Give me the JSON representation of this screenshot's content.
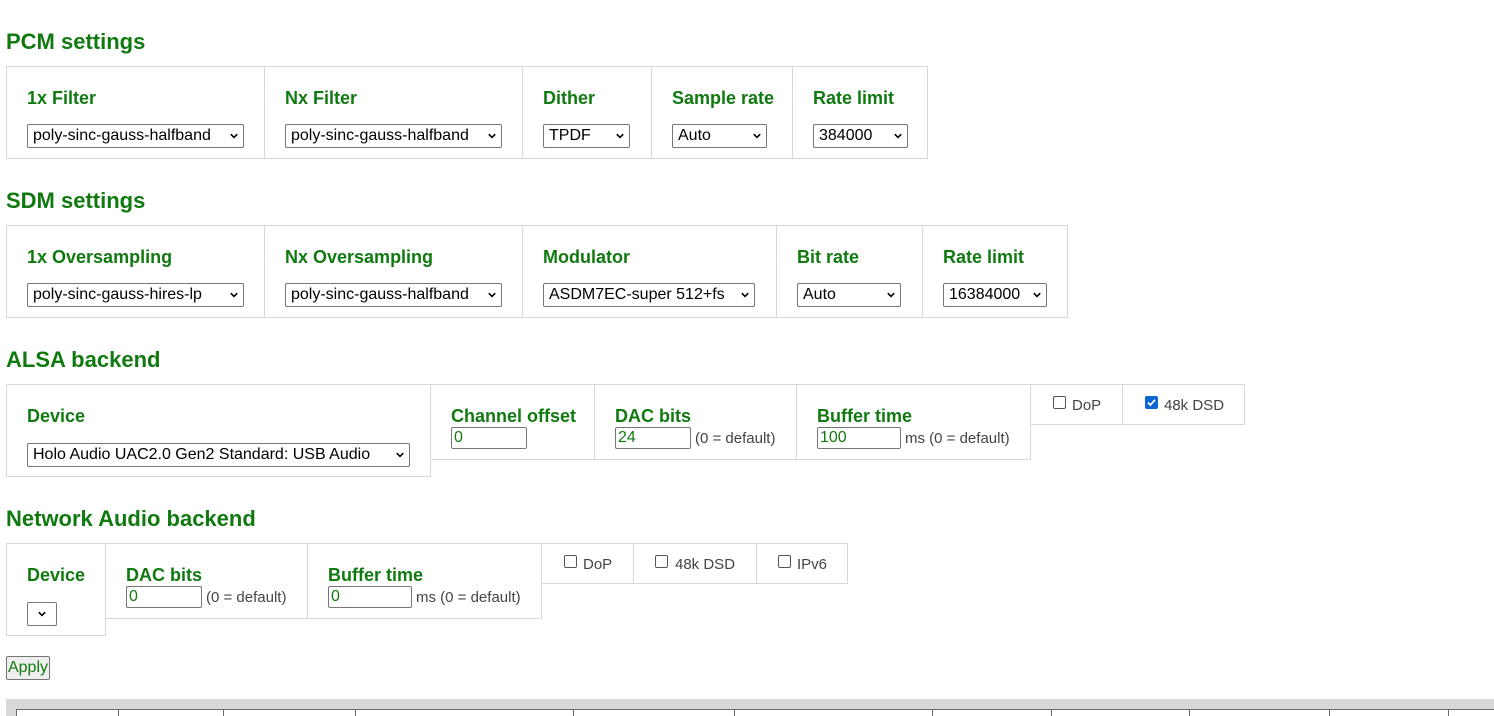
{
  "pcm": {
    "title": "PCM settings",
    "filter1x": {
      "label": "1x Filter",
      "value": "poly-sinc-gauss-halfband"
    },
    "filterNx": {
      "label": "Nx Filter",
      "value": "poly-sinc-gauss-halfband"
    },
    "dither": {
      "label": "Dither",
      "value": "TPDF"
    },
    "sample_rate": {
      "label": "Sample rate",
      "value": "Auto"
    },
    "rate_limit": {
      "label": "Rate limit",
      "value": "384000"
    }
  },
  "sdm": {
    "title": "SDM settings",
    "oversampling1x": {
      "label": "1x Oversampling",
      "value": "poly-sinc-gauss-hires-lp"
    },
    "oversamplingNx": {
      "label": "Nx Oversampling",
      "value": "poly-sinc-gauss-halfband"
    },
    "modulator": {
      "label": "Modulator",
      "value": "ASDM7EC-super 512+fs"
    },
    "bit_rate": {
      "label": "Bit rate",
      "value": "Auto"
    },
    "rate_limit": {
      "label": "Rate limit",
      "value": "16384000"
    }
  },
  "alsa": {
    "title": "ALSA backend",
    "device": {
      "label": "Device",
      "value": "Holo Audio UAC2.0 Gen2 Standard: USB Audio"
    },
    "channel_offset": {
      "label": "Channel offset",
      "value": "0"
    },
    "dac_bits": {
      "label": "DAC bits",
      "value": "24",
      "hint": "(0 = default)"
    },
    "buffer_time": {
      "label": "Buffer time",
      "value": "100",
      "hint": "ms (0 = default)"
    },
    "dop": {
      "label": "DoP",
      "checked": false
    },
    "dsd48k": {
      "label": "48k DSD",
      "checked": true
    }
  },
  "network": {
    "title": "Network Audio backend",
    "device": {
      "label": "Device",
      "value": ""
    },
    "dac_bits": {
      "label": "DAC bits",
      "value": "0",
      "hint": "(0 = default)"
    },
    "buffer_time": {
      "label": "Buffer time",
      "value": "0",
      "hint": "ms (0 = default)"
    },
    "dop": {
      "label": "DoP",
      "checked": false
    },
    "dsd48k": {
      "label": "48k DSD",
      "checked": false
    },
    "ipv6": {
      "label": "IPv6",
      "checked": false
    }
  },
  "apply_label": "Apply",
  "colors": {
    "heading": "#107a10",
    "checkbox_checked": "#0b66d6",
    "cell_border": "#d8d8d8"
  }
}
